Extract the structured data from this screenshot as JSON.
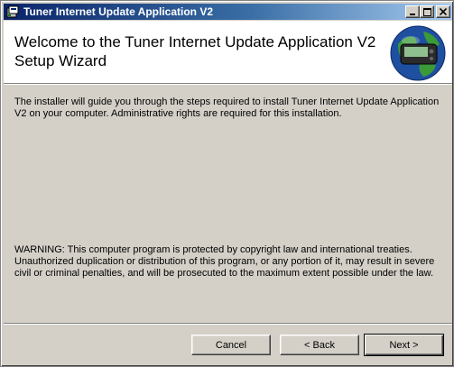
{
  "window": {
    "title": "Tuner Internet Update Application V2",
    "title_buttons": [
      "minimize",
      "maximize",
      "close"
    ]
  },
  "banner": {
    "heading": "Welcome to the Tuner Internet Update Application V2 Setup Wizard",
    "logo_icon": "globe-device-icon"
  },
  "body": {
    "intro": "The installer will guide you through the steps required to install Tuner Internet Update Application V2 on your computer. Administrative rights are required for this installation.",
    "warning": "WARNING: This computer program is protected by copyright law and international treaties. Unauthorized duplication or distribution of this program, or any portion of it, may result in severe civil or criminal penalties, and will be prosecuted to the maximum extent possible under the law."
  },
  "buttons": {
    "cancel": "Cancel",
    "back": "< Back",
    "next": "Next >"
  },
  "colors": {
    "titlebar_start": "#0a246a",
    "titlebar_end": "#a6caf0",
    "face": "#d4d0c8",
    "banner_bg": "#ffffff"
  }
}
